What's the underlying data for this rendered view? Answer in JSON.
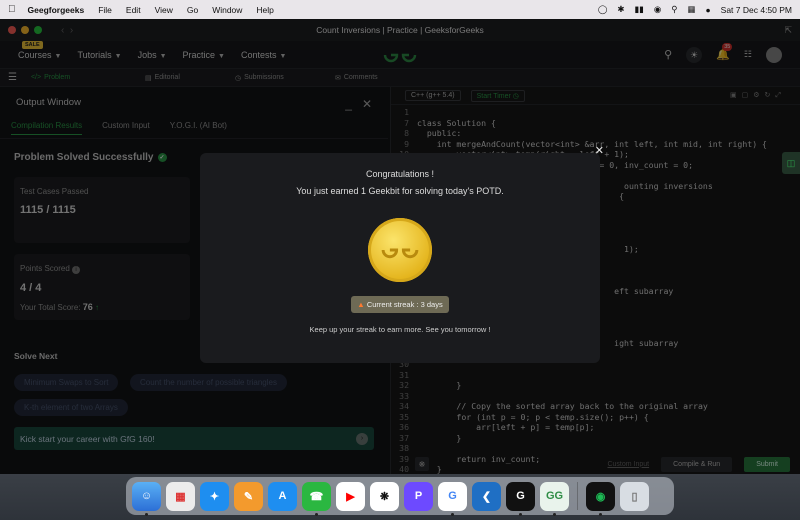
{
  "menubar": {
    "app": "Geegforgeeks",
    "items": [
      "File",
      "Edit",
      "View",
      "Go",
      "Window",
      "Help"
    ],
    "datetime": "Sat 7 Dec  4:50 PM"
  },
  "window": {
    "title": "Count Inversions | Practice | GeeksforGeeks"
  },
  "sitenav": {
    "sale_badge": "SALE",
    "items": [
      "Courses",
      "Tutorials",
      "Jobs",
      "Practice",
      "Contests"
    ],
    "notification_count": "35"
  },
  "tabs": [
    "Problem",
    "Editorial",
    "Submissions",
    "Comments"
  ],
  "output": {
    "title": "Output Window",
    "subtabs": [
      "Compilation Results",
      "Custom Input",
      "Y.O.G.I. (AI Bot)"
    ],
    "status": "Problem Solved Successfully",
    "tests_label": "Test Cases Passed",
    "tests_value": "1115 / 1115",
    "points_label": "Points Scored",
    "points_value": "4 / 4",
    "total_label": "Your Total Score:",
    "total_value": "76",
    "solve_next": "Solve Next",
    "chips": [
      "Minimum Swaps to Sort",
      "Count the number of possible triangles",
      "K-th element of two Arrays"
    ],
    "banner": "Kick start your career with GfG 160!"
  },
  "editor": {
    "language": "C++ (g++ 5.4)",
    "timer": "Start Timer",
    "lines": [
      {
        "n": "1",
        "t": ""
      },
      {
        "n": "7",
        "t": "class Solution {"
      },
      {
        "n": "8",
        "t": "  public:"
      },
      {
        "n": "9",
        "t": "    int mergeAndCount(vector<int> &arr, int left, int mid, int right) {"
      },
      {
        "n": "10",
        "t": "        vector<int> temp(right - left + 1);"
      },
      {
        "n": "11",
        "t": "        int i = left, j = mid + 1, k = 0, inv_count = 0;"
      },
      {
        "n": "12",
        "t": ""
      },
      {
        "n": "13",
        "t": "                                          ounting inversions"
      },
      {
        "n": "14",
        "t": "                                         {"
      },
      {
        "n": "15",
        "t": ""
      },
      {
        "n": "16",
        "t": ""
      },
      {
        "n": "17",
        "t": ""
      },
      {
        "n": "18",
        "t": ""
      },
      {
        "n": "19",
        "t": "                                          1);"
      },
      {
        "n": "20",
        "t": ""
      },
      {
        "n": "21",
        "t": ""
      },
      {
        "n": "22",
        "t": ""
      },
      {
        "n": "23",
        "t": "                                        eft subarray"
      },
      {
        "n": "24",
        "t": ""
      },
      {
        "n": "25",
        "t": ""
      },
      {
        "n": "26",
        "t": ""
      },
      {
        "n": "27",
        "t": ""
      },
      {
        "n": "28",
        "t": "                                        ight subarray"
      },
      {
        "n": "29",
        "t": ""
      },
      {
        "n": "30",
        "t": ""
      },
      {
        "n": "31",
        "t": ""
      },
      {
        "n": "32",
        "t": "        }"
      },
      {
        "n": "33",
        "t": ""
      },
      {
        "n": "34",
        "t": "        // Copy the sorted array back to the original array"
      },
      {
        "n": "35",
        "t": "        for (int p = 0; p < temp.size(); p++) {"
      },
      {
        "n": "36",
        "t": "            arr[left + p] = temp[p];"
      },
      {
        "n": "37",
        "t": "        }"
      },
      {
        "n": "38",
        "t": ""
      },
      {
        "n": "39",
        "t": "        return inv_count;"
      },
      {
        "n": "40",
        "t": "    }"
      }
    ],
    "custom_input": "Custom Input",
    "compile_run": "Compile & Run",
    "submit": "Submit"
  },
  "modal": {
    "title": "Congratulations !",
    "message": "You just earned 1 Geekbit for solving today's POTD.",
    "streak": "Current streak : 3 days",
    "footer": "Keep up your streak to earn more. See you tomorrow !"
  },
  "dock": [
    "Finder",
    "Launchpad",
    "Safari",
    "Pages",
    "App Store",
    "WhatsApp",
    "YouTube",
    "ChatGPT",
    "Proton",
    "Google Chrome",
    "Visual Studio Code",
    "GfG App",
    "GeeksforGeeks",
    "Spotify",
    "Trash"
  ],
  "colors": {
    "brand_green": "#2f8d46",
    "accent_green": "#2b9a48",
    "coin_gold": "#e4b41c",
    "modal_bg": "#1a1b1e"
  }
}
